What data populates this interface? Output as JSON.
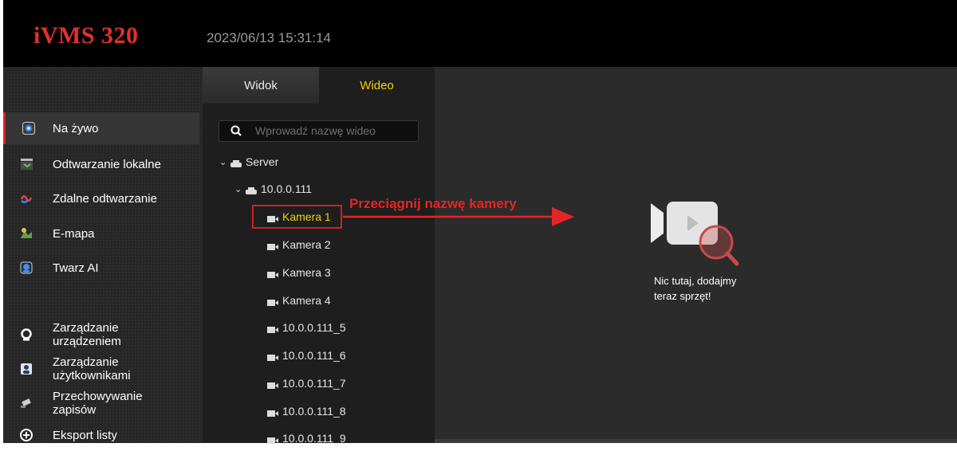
{
  "app": {
    "title": "iVMS 320",
    "datetime": "2023/06/13 15:31:14"
  },
  "sidebar": {
    "items": [
      {
        "label": "Na żywo",
        "icon": "live-icon",
        "active": true
      },
      {
        "label": "Odtwarzanie lokalne",
        "icon": "local-playback-icon"
      },
      {
        "label": "Zdalne odtwarzanie",
        "icon": "remote-playback-icon"
      },
      {
        "label": "E-mapa",
        "icon": "emap-icon"
      },
      {
        "label": "Twarz AI",
        "icon": "face-ai-icon"
      }
    ],
    "management": [
      {
        "line1": "Zarządzanie",
        "line2": "urządzeniem",
        "icon": "device-management-icon"
      },
      {
        "line1": "Zarządzanie",
        "line2": "użytkownikami",
        "icon": "user-management-icon"
      },
      {
        "line1": "Przechowywanie",
        "line2": "zapisów",
        "icon": "storage-icon"
      },
      {
        "line1": "Eksport listy",
        "line2": "",
        "icon": "export-icon"
      }
    ]
  },
  "panel": {
    "tabs": [
      "Widok",
      "Wideo"
    ],
    "active_tab": "Wideo",
    "search_placeholder": "Wprowadź nazwę wideo",
    "tree": {
      "root": "Server",
      "device": "10.0.0.111",
      "cameras": [
        "Kamera 1",
        "Kamera 2",
        "Kamera 3",
        "Kamera 4",
        "10.0.0.111_5",
        "10.0.0.111_6",
        "10.0.0.111_7",
        "10.0.0.111_8",
        "10.0.0.111_9"
      ],
      "selected": "Kamera 1"
    }
  },
  "annotation": {
    "text": "Przeciągnij nazwę kamery",
    "color": "#e52525"
  },
  "main": {
    "empty_line1": "Nic tutaj, dodajmy",
    "empty_line2": "teraz sprzęt!"
  },
  "colors": {
    "accent_yellow": "#f0d000",
    "brand_red": "#e0322b"
  }
}
